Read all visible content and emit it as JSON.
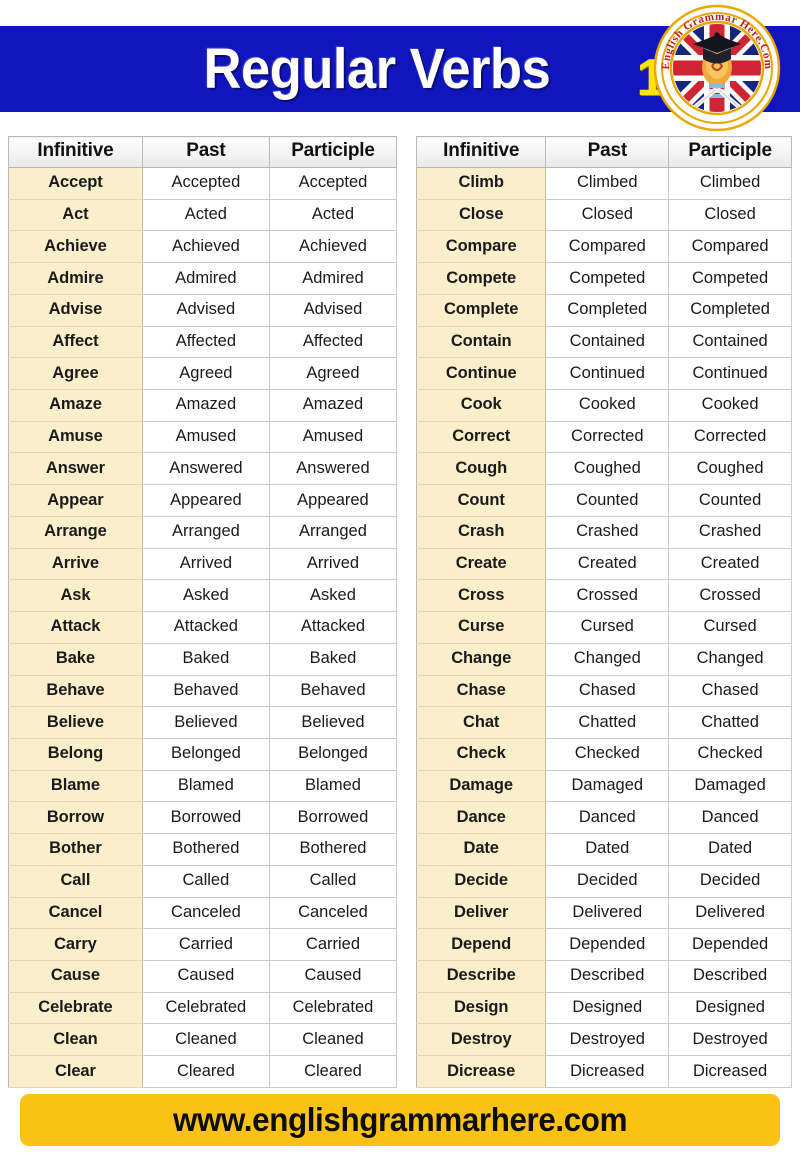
{
  "header": {
    "title": "Regular Verbs",
    "page_number": "1",
    "banner_color": "#1116BC",
    "title_color": "#FFFFFF",
    "page_number_color": "#FFE400",
    "logo": {
      "name": "english-grammar-here-logo",
      "arc_text": "English Grammar Here.Com",
      "arc_text_color": "#C0201C",
      "ring_color": "#E8A800",
      "elements": [
        "uk-flag",
        "graduation-cap",
        "lightbulb"
      ]
    }
  },
  "columns": [
    "Infinitive",
    "Past",
    "Participle"
  ],
  "tables": [
    {
      "id": "left",
      "headers": [
        "Infinitive",
        "Past",
        "Participle"
      ],
      "rows": [
        [
          "Accept",
          "Accepted",
          "Accepted"
        ],
        [
          "Act",
          "Acted",
          "Acted"
        ],
        [
          "Achieve",
          "Achieved",
          "Achieved"
        ],
        [
          "Admire",
          "Admired",
          "Admired"
        ],
        [
          "Advise",
          "Advised",
          "Advised"
        ],
        [
          "Affect",
          "Affected",
          "Affected"
        ],
        [
          "Agree",
          "Agreed",
          "Agreed"
        ],
        [
          "Amaze",
          "Amazed",
          "Amazed"
        ],
        [
          "Amuse",
          "Amused",
          "Amused"
        ],
        [
          "Answer",
          "Answered",
          "Answered"
        ],
        [
          "Appear",
          "Appeared",
          "Appeared"
        ],
        [
          "Arrange",
          "Arranged",
          "Arranged"
        ],
        [
          "Arrive",
          "Arrived",
          "Arrived"
        ],
        [
          "Ask",
          "Asked",
          "Asked"
        ],
        [
          "Attack",
          "Attacked",
          "Attacked"
        ],
        [
          "Bake",
          "Baked",
          "Baked"
        ],
        [
          "Behave",
          "Behaved",
          "Behaved"
        ],
        [
          "Believe",
          "Believed",
          "Believed"
        ],
        [
          "Belong",
          "Belonged",
          "Belonged"
        ],
        [
          "Blame",
          "Blamed",
          "Blamed"
        ],
        [
          "Borrow",
          "Borrowed",
          "Borrowed"
        ],
        [
          "Bother",
          "Bothered",
          "Bothered"
        ],
        [
          "Call",
          "Called",
          "Called"
        ],
        [
          "Cancel",
          "Canceled",
          "Canceled"
        ],
        [
          "Carry",
          "Carried",
          "Carried"
        ],
        [
          "Cause",
          "Caused",
          "Caused"
        ],
        [
          "Celebrate",
          "Celebrated",
          "Celebrated"
        ],
        [
          "Clean",
          "Cleaned",
          "Cleaned"
        ],
        [
          "Clear",
          "Cleared",
          "Cleared"
        ]
      ]
    },
    {
      "id": "right",
      "headers": [
        "Infinitive",
        "Past",
        "Participle"
      ],
      "rows": [
        [
          "Climb",
          "Climbed",
          "Climbed"
        ],
        [
          "Close",
          "Closed",
          "Closed"
        ],
        [
          "Compare",
          "Compared",
          "Compared"
        ],
        [
          "Compete",
          "Competed",
          "Competed"
        ],
        [
          "Complete",
          "Completed",
          "Completed"
        ],
        [
          "Contain",
          "Contained",
          "Contained"
        ],
        [
          "Continue",
          "Continued",
          "Continued"
        ],
        [
          "Cook",
          "Cooked",
          "Cooked"
        ],
        [
          "Correct",
          "Corrected",
          "Corrected"
        ],
        [
          "Cough",
          "Coughed",
          "Coughed"
        ],
        [
          "Count",
          "Counted",
          "Counted"
        ],
        [
          "Crash",
          "Crashed",
          "Crashed"
        ],
        [
          "Create",
          "Created",
          "Created"
        ],
        [
          "Cross",
          "Crossed",
          "Crossed"
        ],
        [
          "Curse",
          "Cursed",
          "Cursed"
        ],
        [
          "Change",
          "Changed",
          "Changed"
        ],
        [
          "Chase",
          "Chased",
          "Chased"
        ],
        [
          "Chat",
          "Chatted",
          "Chatted"
        ],
        [
          "Check",
          "Checked",
          "Checked"
        ],
        [
          "Damage",
          "Damaged",
          "Damaged"
        ],
        [
          "Dance",
          "Danced",
          "Danced"
        ],
        [
          "Date",
          "Dated",
          "Dated"
        ],
        [
          "Decide",
          "Decided",
          "Decided"
        ],
        [
          "Deliver",
          "Delivered",
          "Delivered"
        ],
        [
          "Depend",
          "Depended",
          "Depended"
        ],
        [
          "Describe",
          "Described",
          "Described"
        ],
        [
          "Design",
          "Designed",
          "Designed"
        ],
        [
          "Destroy",
          "Destroyed",
          "Destroyed"
        ],
        [
          "Dicrease",
          "Dicreased",
          "Dicreased"
        ]
      ]
    }
  ],
  "footer": {
    "url": "www.englishgrammarhere.com",
    "background_color": "#FCC212",
    "text_color": "#0D0D0D"
  },
  "theme": {
    "infinitive_cell_bg": "#FBEFCB",
    "header_cell_bg": "#F0F0F0",
    "grid_line": "#C6C6C6",
    "page_bg": "#FFFFFF"
  }
}
